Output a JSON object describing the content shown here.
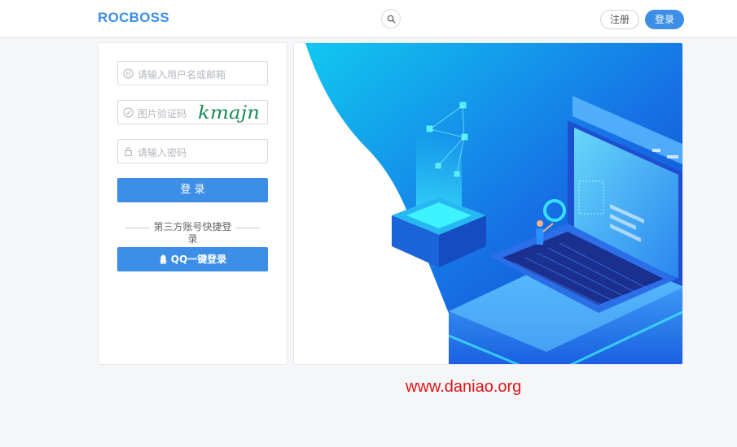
{
  "header": {
    "logo": "ROCBOSS",
    "register_label": "注册",
    "login_label": "登录"
  },
  "form": {
    "username_placeholder": "请输入用户名或邮箱",
    "captcha_placeholder": "图片验证码",
    "captcha_text": "kmajn",
    "password_placeholder": "请输入密码",
    "submit_label": "登 录",
    "third_party_label": "第三方账号快捷登录",
    "qq_label": "QQ一键登录"
  },
  "watermark": "www.daniao.org",
  "colors": {
    "accent": "#3d8ee6",
    "watermark": "#e0151a",
    "captcha": "#1f8a5a"
  },
  "icons": [
    "search-icon",
    "user-icon",
    "check-circle-icon",
    "lock-icon",
    "qq-icon"
  ]
}
